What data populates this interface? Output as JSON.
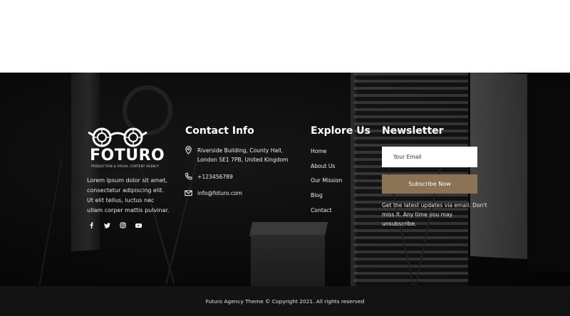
{
  "brand": {
    "name": "FOTURO",
    "tagline": "PRODUCTION & VISUAL CONTENT AGENCY",
    "description": "Lorem ipsum dolor sit amet, consectetur adipiscing elit. Ut elit tellus, luctus nec ullam corper mattis pulvinar.",
    "social_icons": [
      "facebook-icon",
      "twitter-icon",
      "instagram-icon",
      "youtube-icon"
    ]
  },
  "contact": {
    "heading": "Contact Info",
    "address": "Riverside Building, County Hall, London SE1 7PB, United Kingdom",
    "phone": "+123456789",
    "email": "info@foturo.com"
  },
  "explore": {
    "heading": "Explore Us",
    "links": [
      "Home",
      "About Us",
      "Our Mission",
      "Blog",
      "Contact"
    ]
  },
  "newsletter": {
    "heading": "Newsletter",
    "email_placeholder": "Your Email",
    "button_label": "Subscribe Now",
    "note": "Get the latest updates via email. Don't miss it. Any time you may unsubscribe."
  },
  "footer": {
    "copyright": "Futuro Agency Theme © Copyright 2021. All rights reserved"
  },
  "colors": {
    "accent": "#8b7355",
    "bottom_bar": "#131313"
  }
}
